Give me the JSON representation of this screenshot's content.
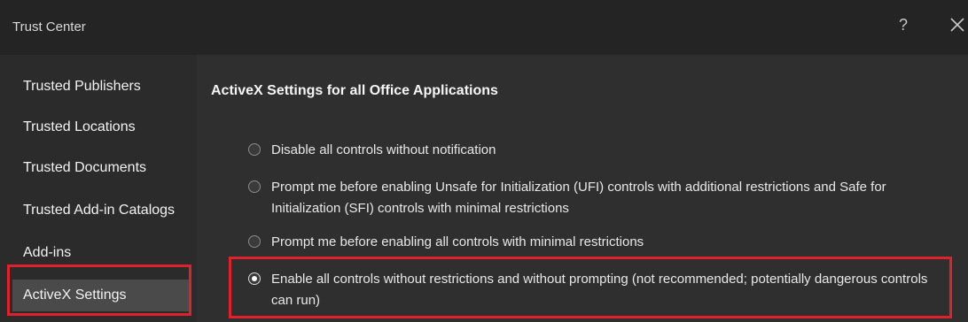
{
  "window": {
    "title": "Trust Center",
    "help_label": "?"
  },
  "sidebar": {
    "items": [
      {
        "label": "Trusted Publishers"
      },
      {
        "label": "Trusted Locations"
      },
      {
        "label": "Trusted Documents"
      },
      {
        "label": "Trusted Add-in Catalogs"
      },
      {
        "label": "Add-ins"
      },
      {
        "label": "ActiveX Settings",
        "selected": true
      }
    ]
  },
  "main": {
    "section_title": "ActiveX Settings for all Office Applications",
    "options": [
      {
        "label": "Disable all controls without notification",
        "checked": false
      },
      {
        "label": "Prompt me before enabling Unsafe for Initialization (UFI) controls with additional restrictions and Safe for Initialization (SFI) controls with minimal restrictions",
        "checked": false
      },
      {
        "label": "Prompt me before enabling all controls with minimal restrictions",
        "checked": false
      },
      {
        "label": "Enable all controls without restrictions and without prompting (not recommended; potentially dangerous controls can run)",
        "checked": true
      }
    ]
  },
  "colors": {
    "highlight": "#e0202a",
    "titlebar": "#242424",
    "background": "#2f2f2f"
  }
}
